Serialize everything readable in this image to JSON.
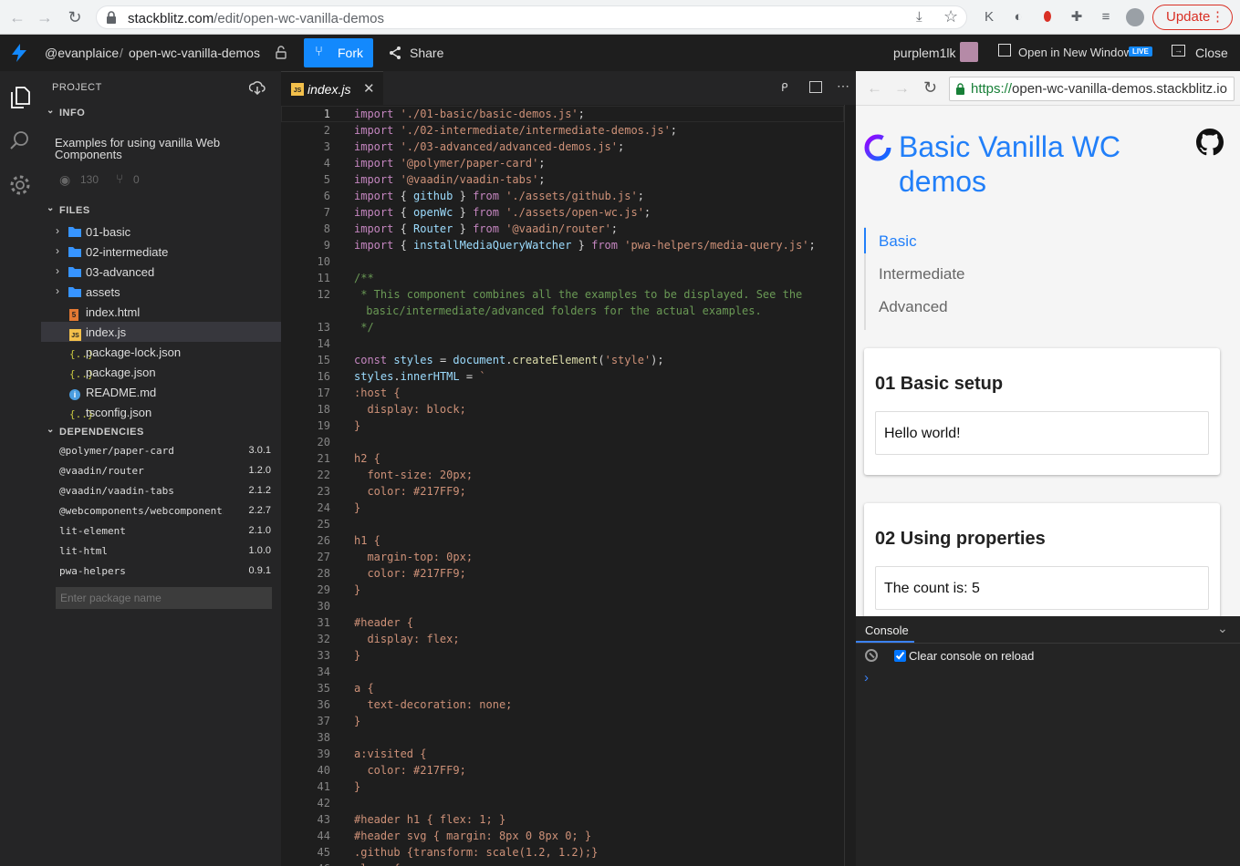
{
  "browser": {
    "url_host": "stackblitz.com",
    "url_path": "/edit/open-wc-vanilla-demos",
    "update_label": "Update"
  },
  "header": {
    "owner": "@evanplaice",
    "separator": "/",
    "project": "open-wc-vanilla-demos",
    "fork_label": "Fork",
    "share_label": "Share",
    "username": "purplem1lk",
    "open_new_window": "Open in New Window",
    "live_badge": "LIVE",
    "close_label": "Close"
  },
  "sidebar": {
    "title": "PROJECT",
    "info_title": "INFO",
    "description": "Examples for using vanilla Web Components",
    "views": "130",
    "forks": "0",
    "files_title": "FILES",
    "files": [
      {
        "name": "01-basic",
        "type": "folder"
      },
      {
        "name": "02-intermediate",
        "type": "folder"
      },
      {
        "name": "03-advanced",
        "type": "folder"
      },
      {
        "name": "assets",
        "type": "folder"
      },
      {
        "name": "index.html",
        "type": "html"
      },
      {
        "name": "index.js",
        "type": "js"
      },
      {
        "name": "package-lock.json",
        "type": "json"
      },
      {
        "name": "package.json",
        "type": "json"
      },
      {
        "name": "README.md",
        "type": "md"
      },
      {
        "name": "tsconfig.json",
        "type": "json"
      }
    ],
    "deps_title": "DEPENDENCIES",
    "dependencies": [
      {
        "name": "@polymer/paper-card",
        "version": "3.0.1"
      },
      {
        "name": "@vaadin/router",
        "version": "1.2.0"
      },
      {
        "name": "@vaadin/vaadin-tabs",
        "version": "2.1.2"
      },
      {
        "name": "@webcomponents/webcomponentsjs",
        "version": "2.2.7"
      },
      {
        "name": "lit-element",
        "version": "2.1.0"
      },
      {
        "name": "lit-html",
        "version": "1.0.0"
      },
      {
        "name": "pwa-helpers",
        "version": "0.9.1"
      }
    ],
    "package_placeholder": "Enter package name"
  },
  "editor": {
    "tab_badge": "JS",
    "tab_label": "index.js",
    "lines": [
      {
        "n": "1",
        "t": [
          [
            "kw",
            "import "
          ],
          [
            "str",
            "'./01-basic/basic-demos.js'"
          ],
          [
            "",
            "; "
          ]
        ]
      },
      {
        "n": "2",
        "t": [
          [
            "kw",
            "import "
          ],
          [
            "str",
            "'./02-intermediate/intermediate-demos.js'"
          ],
          [
            "",
            ";"
          ]
        ]
      },
      {
        "n": "3",
        "t": [
          [
            "kw",
            "import "
          ],
          [
            "str",
            "'./03-advanced/advanced-demos.js'"
          ],
          [
            "",
            ";"
          ]
        ]
      },
      {
        "n": "4",
        "t": [
          [
            "kw",
            "import "
          ],
          [
            "str",
            "'@polymer/paper-card'"
          ],
          [
            "",
            ";"
          ]
        ]
      },
      {
        "n": "5",
        "t": [
          [
            "kw",
            "import "
          ],
          [
            "str",
            "'@vaadin/vaadin-tabs'"
          ],
          [
            "",
            ";"
          ]
        ]
      },
      {
        "n": "6",
        "t": [
          [
            "kw",
            "import "
          ],
          [
            "",
            "{ "
          ],
          [
            "id",
            "github"
          ],
          [
            "",
            " } "
          ],
          [
            "kw",
            "from "
          ],
          [
            "str",
            "'./assets/github.js'"
          ],
          [
            "",
            ";"
          ]
        ]
      },
      {
        "n": "7",
        "t": [
          [
            "kw",
            "import "
          ],
          [
            "",
            "{ "
          ],
          [
            "id",
            "openWc"
          ],
          [
            "",
            " } "
          ],
          [
            "kw",
            "from "
          ],
          [
            "str",
            "'./assets/open-wc.js'"
          ],
          [
            "",
            ";"
          ]
        ]
      },
      {
        "n": "8",
        "t": [
          [
            "kw",
            "import "
          ],
          [
            "",
            "{ "
          ],
          [
            "id",
            "Router"
          ],
          [
            "",
            " } "
          ],
          [
            "kw",
            "from "
          ],
          [
            "str",
            "'@vaadin/router'"
          ],
          [
            "",
            ";"
          ]
        ]
      },
      {
        "n": "9",
        "t": [
          [
            "kw",
            "import "
          ],
          [
            "",
            "{ "
          ],
          [
            "id",
            "installMediaQueryWatcher"
          ],
          [
            "",
            " } "
          ],
          [
            "kw",
            "from "
          ],
          [
            "str",
            "'pwa-helpers/media-query.js'"
          ],
          [
            "",
            ";"
          ]
        ]
      },
      {
        "n": "10",
        "t": []
      },
      {
        "n": "11",
        "t": [
          [
            "cm",
            "/**"
          ]
        ]
      },
      {
        "n": "12",
        "t": [
          [
            "cm",
            " * This component combines all the examples to be displayed. See the"
          ]
        ]
      },
      {
        "n": "",
        "t": [
          [
            "cm",
            " basic/intermediate/advanced folders for the actual examples."
          ]
        ]
      },
      {
        "n": "13",
        "t": [
          [
            "cm",
            " */"
          ]
        ]
      },
      {
        "n": "14",
        "t": []
      },
      {
        "n": "15",
        "t": [
          [
            "kw",
            "const "
          ],
          [
            "id",
            "styles"
          ],
          [
            "",
            " = "
          ],
          [
            "id",
            "document"
          ],
          [
            "",
            "."
          ],
          [
            "fn",
            "createElement"
          ],
          [
            "",
            "("
          ],
          [
            "str",
            "'style'"
          ],
          [
            "",
            ");"
          ]
        ]
      },
      {
        "n": "16",
        "t": [
          [
            "id",
            "styles"
          ],
          [
            "",
            "."
          ],
          [
            "id",
            "innerHTML"
          ],
          [
            "",
            " = "
          ],
          [
            "str",
            "`"
          ]
        ]
      },
      {
        "n": "17",
        "t": [
          [
            "str",
            ":host {"
          ]
        ]
      },
      {
        "n": "18",
        "t": [
          [
            "str",
            "  display: block;"
          ]
        ]
      },
      {
        "n": "19",
        "t": [
          [
            "str",
            "}"
          ]
        ]
      },
      {
        "n": "20",
        "t": []
      },
      {
        "n": "21",
        "t": [
          [
            "str",
            "h2 {"
          ]
        ]
      },
      {
        "n": "22",
        "t": [
          [
            "str",
            "  font-size: 20px;"
          ]
        ]
      },
      {
        "n": "23",
        "t": [
          [
            "str",
            "  color: #217FF9;"
          ]
        ]
      },
      {
        "n": "24",
        "t": [
          [
            "str",
            "}"
          ]
        ]
      },
      {
        "n": "25",
        "t": []
      },
      {
        "n": "26",
        "t": [
          [
            "str",
            "h1 {"
          ]
        ]
      },
      {
        "n": "27",
        "t": [
          [
            "str",
            "  margin-top: 0px;"
          ]
        ]
      },
      {
        "n": "28",
        "t": [
          [
            "str",
            "  color: #217FF9;"
          ]
        ]
      },
      {
        "n": "29",
        "t": [
          [
            "str",
            "}"
          ]
        ]
      },
      {
        "n": "30",
        "t": []
      },
      {
        "n": "31",
        "t": [
          [
            "str",
            "#header {"
          ]
        ]
      },
      {
        "n": "32",
        "t": [
          [
            "str",
            "  display: flex;"
          ]
        ]
      },
      {
        "n": "33",
        "t": [
          [
            "str",
            "}"
          ]
        ]
      },
      {
        "n": "34",
        "t": []
      },
      {
        "n": "35",
        "t": [
          [
            "str",
            "a {"
          ]
        ]
      },
      {
        "n": "36",
        "t": [
          [
            "str",
            "  text-decoration: none;"
          ]
        ]
      },
      {
        "n": "37",
        "t": [
          [
            "str",
            "}"
          ]
        ]
      },
      {
        "n": "38",
        "t": []
      },
      {
        "n": "39",
        "t": [
          [
            "str",
            "a:visited {"
          ]
        ]
      },
      {
        "n": "40",
        "t": [
          [
            "str",
            "  color: #217FF9;"
          ]
        ]
      },
      {
        "n": "41",
        "t": [
          [
            "str",
            "}"
          ]
        ]
      },
      {
        "n": "42",
        "t": []
      },
      {
        "n": "43",
        "t": [
          [
            "str",
            "#header h1 { flex: 1; }"
          ]
        ]
      },
      {
        "n": "44",
        "t": [
          [
            "str",
            "#header svg { margin: 8px 0 8px 0; }"
          ]
        ]
      },
      {
        "n": "45",
        "t": [
          [
            "str",
            ".github {transform: scale(1.2, 1.2);}"
          ]
        ]
      },
      {
        "n": "46",
        "t": [
          [
            "str",
            ".logo {"
          ]
        ]
      }
    ]
  },
  "preview": {
    "url_scheme": "https://",
    "url_host": "open-wc-vanilla-demos.stackblitz.io",
    "title": "Basic Vanilla WC demos",
    "tabs": [
      "Basic",
      "Intermediate",
      "Advanced"
    ],
    "cards": [
      {
        "heading": "01 Basic setup",
        "content": "Hello world!"
      },
      {
        "heading": "02 Using properties",
        "content": "The count is: 5"
      }
    ]
  },
  "console": {
    "title": "Console",
    "clear_label": "Clear console on reload",
    "clear_checked": true,
    "prompt": "›"
  },
  "colors": {
    "accent": "#1389fd",
    "preview_title": "#217ff9",
    "update": "#d93025"
  }
}
